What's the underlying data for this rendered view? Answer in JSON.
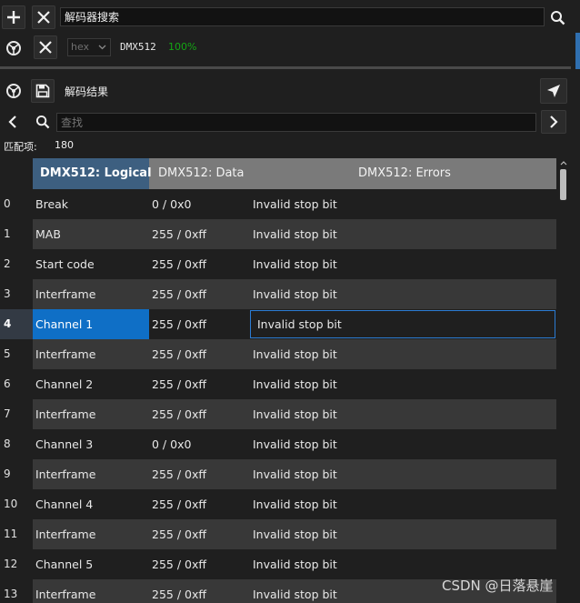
{
  "search_panel": {
    "add_icon": "plus-icon",
    "clear_icon": "close-icon",
    "query": "解码器搜索",
    "search_icon": "magnifier-icon"
  },
  "decoder_bar": {
    "settings_icon": "gear-icon",
    "remove_icon": "close-icon",
    "format_select": "hex",
    "decoder_name": "DMX512",
    "progress": "100%",
    "progress_color": "#14a514"
  },
  "results_panel": {
    "settings_icon": "gear-icon",
    "save_icon": "save-icon",
    "title": "解码结果",
    "locate_icon": "navigate-arrow-icon",
    "prev_icon": "chevron-left-icon",
    "find_icon": "search-icon",
    "find_placeholder": "查找",
    "next_icon": "chevron-right-icon",
    "match_label": "匹配项:",
    "match_count": "180"
  },
  "table": {
    "headers": [
      "DMX512: Logical",
      "DMX512: Data",
      "DMX512: Errors"
    ],
    "rows": [
      {
        "num": "0",
        "logical": "Break",
        "data": "0 / 0x0",
        "errors": "Invalid stop bit"
      },
      {
        "num": "1",
        "logical": "MAB",
        "data": "255 / 0xff",
        "errors": "Invalid stop bit"
      },
      {
        "num": "2",
        "logical": "Start code",
        "data": "255 / 0xff",
        "errors": "Invalid stop bit"
      },
      {
        "num": "3",
        "logical": "Interframe",
        "data": "255 / 0xff",
        "errors": "Invalid stop bit"
      },
      {
        "num": "4",
        "logical": "Channel 1",
        "data": "255 / 0xff",
        "errors": "Invalid stop bit"
      },
      {
        "num": "5",
        "logical": "Interframe",
        "data": "255 / 0xff",
        "errors": "Invalid stop bit"
      },
      {
        "num": "6",
        "logical": "Channel 2",
        "data": "255 / 0xff",
        "errors": "Invalid stop bit"
      },
      {
        "num": "7",
        "logical": "Interframe",
        "data": "255 / 0xff",
        "errors": "Invalid stop bit"
      },
      {
        "num": "8",
        "logical": "Channel 3",
        "data": "0 / 0x0",
        "errors": "Invalid stop bit"
      },
      {
        "num": "9",
        "logical": "Interframe",
        "data": "255 / 0xff",
        "errors": "Invalid stop bit"
      },
      {
        "num": "10",
        "logical": "Channel 4",
        "data": "255 / 0xff",
        "errors": "Invalid stop bit"
      },
      {
        "num": "11",
        "logical": "Interframe",
        "data": "255 / 0xff",
        "errors": "Invalid stop bit"
      },
      {
        "num": "12",
        "logical": "Channel 5",
        "data": "255 / 0xff",
        "errors": "Invalid stop bit"
      },
      {
        "num": "13",
        "logical": "Interframe",
        "data": "255 / 0xff",
        "errors": "Invalid stop bit"
      }
    ],
    "selected_row": "4"
  },
  "watermark": "CSDN @日落悬崖",
  "colors": {
    "selection": "#0f6fc6",
    "active_header": "#3d5f80",
    "header_bg": "#7a7a7a",
    "row_alt": "#383838"
  }
}
